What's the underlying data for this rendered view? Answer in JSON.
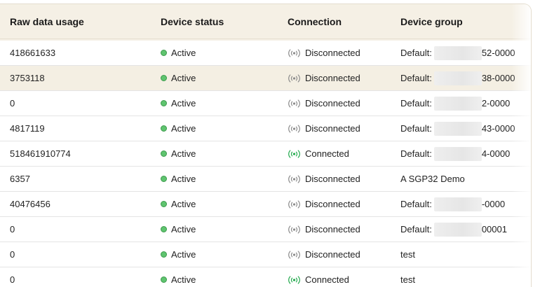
{
  "table": {
    "headers": [
      "Raw data usage",
      "Device status",
      "Connection",
      "Device group"
    ],
    "rows": [
      {
        "usage": "418661633",
        "status": "Active",
        "connection": "Disconnected",
        "connected": false,
        "group_prefix": "Default:",
        "group_suffix": "52-0000",
        "redacted": true,
        "highlight": false
      },
      {
        "usage": "3753118",
        "status": "Active",
        "connection": "Disconnected",
        "connected": false,
        "group_prefix": "Default:",
        "group_suffix": "38-0000",
        "redacted": true,
        "highlight": true
      },
      {
        "usage": "0",
        "status": "Active",
        "connection": "Disconnected",
        "connected": false,
        "group_prefix": "Default:",
        "group_suffix": "2-0000",
        "redacted": true,
        "highlight": false
      },
      {
        "usage": "4817119",
        "status": "Active",
        "connection": "Disconnected",
        "connected": false,
        "group_prefix": "Default:",
        "group_suffix": "43-0000",
        "redacted": true,
        "highlight": false
      },
      {
        "usage": "518461910774",
        "status": "Active",
        "connection": "Connected",
        "connected": true,
        "group_prefix": "Default:",
        "group_suffix": "4-0000",
        "redacted": true,
        "highlight": false
      },
      {
        "usage": "6357",
        "status": "Active",
        "connection": "Disconnected",
        "connected": false,
        "group_prefix": "A SGP32 Demo",
        "group_suffix": "",
        "redacted": false,
        "highlight": false
      },
      {
        "usage": "40476456",
        "status": "Active",
        "connection": "Disconnected",
        "connected": false,
        "group_prefix": "Default:",
        "group_suffix": "-0000",
        "redacted": true,
        "highlight": false
      },
      {
        "usage": "0",
        "status": "Active",
        "connection": "Disconnected",
        "connected": false,
        "group_prefix": "Default:",
        "group_suffix": "00001",
        "redacted": true,
        "highlight": false
      },
      {
        "usage": "0",
        "status": "Active",
        "connection": "Disconnected",
        "connected": false,
        "group_prefix": "test",
        "group_suffix": "",
        "redacted": false,
        "highlight": false
      },
      {
        "usage": "0",
        "status": "Active",
        "connection": "Connected",
        "connected": true,
        "group_prefix": "test",
        "group_suffix": "",
        "redacted": false,
        "highlight": false
      }
    ]
  },
  "colors": {
    "connected": "#1fa84a",
    "disconnected": "#8a8a8a",
    "active_dot": "#5fc46f"
  },
  "icons": {
    "status": "status-dot-icon",
    "connection": "wireless-signal-icon"
  }
}
